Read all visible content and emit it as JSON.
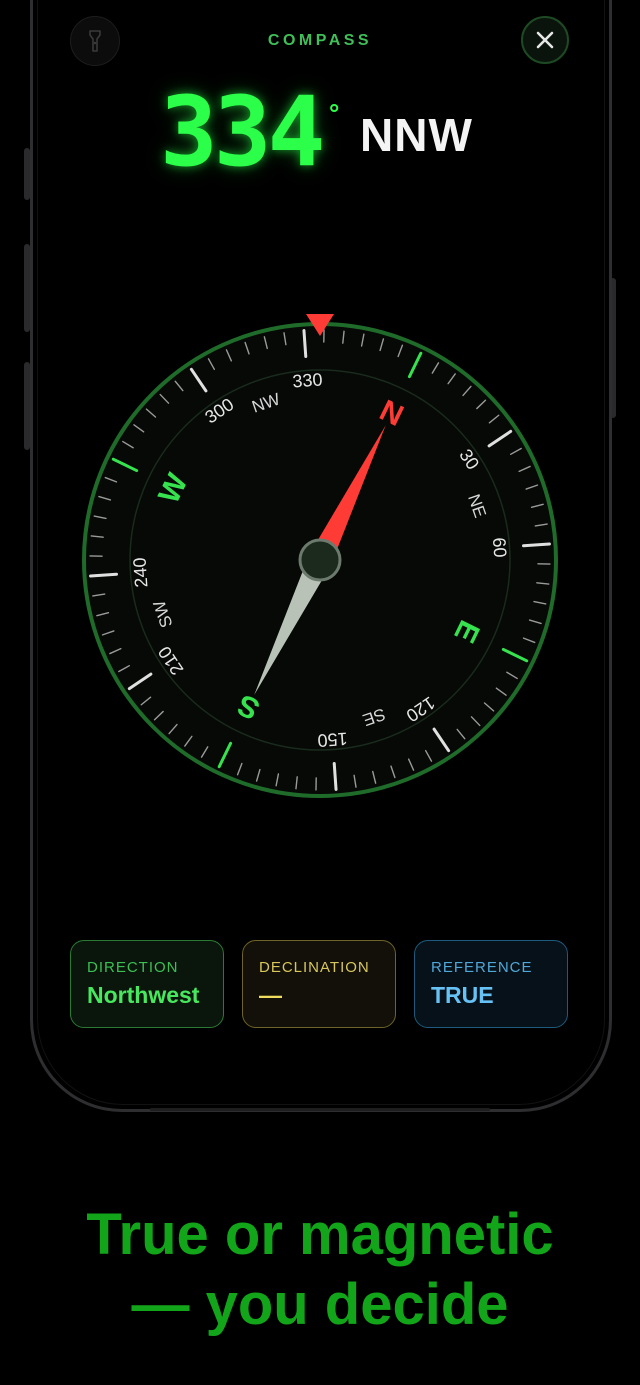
{
  "app": {
    "title": "COMPASS"
  },
  "toolbar": {
    "torch_icon": "flashlight-icon",
    "close_icon": "close-icon",
    "close_glyph": "✕"
  },
  "heading": {
    "degrees": "334",
    "degree_symbol": "°",
    "cardinal": "NNW"
  },
  "compass": {
    "cardinals": [
      "N",
      "E",
      "S",
      "W"
    ],
    "intercardinals": [
      "NE",
      "SE",
      "SW",
      "NW"
    ],
    "degree_labels": [
      "30",
      "60",
      "120",
      "150",
      "210",
      "240",
      "300",
      "330"
    ],
    "heading_deg": 334,
    "colors": {
      "ring": "#1f6b2a",
      "tick": "#9a9a9a",
      "cardinal": "#36e34f",
      "north": "#ff3b36",
      "needle_north": "#ff3b36",
      "needle_south": "#b8c2b6",
      "marker": "#ff3b36"
    }
  },
  "cards": {
    "direction": {
      "label": "DIRECTION",
      "value": "Northwest"
    },
    "declination": {
      "label": "DECLINATION",
      "value": "—"
    },
    "reference": {
      "label": "REFERENCE",
      "value": "TRUE"
    }
  },
  "tagline": {
    "line1": "True or magnetic",
    "line2": "— you decide"
  }
}
